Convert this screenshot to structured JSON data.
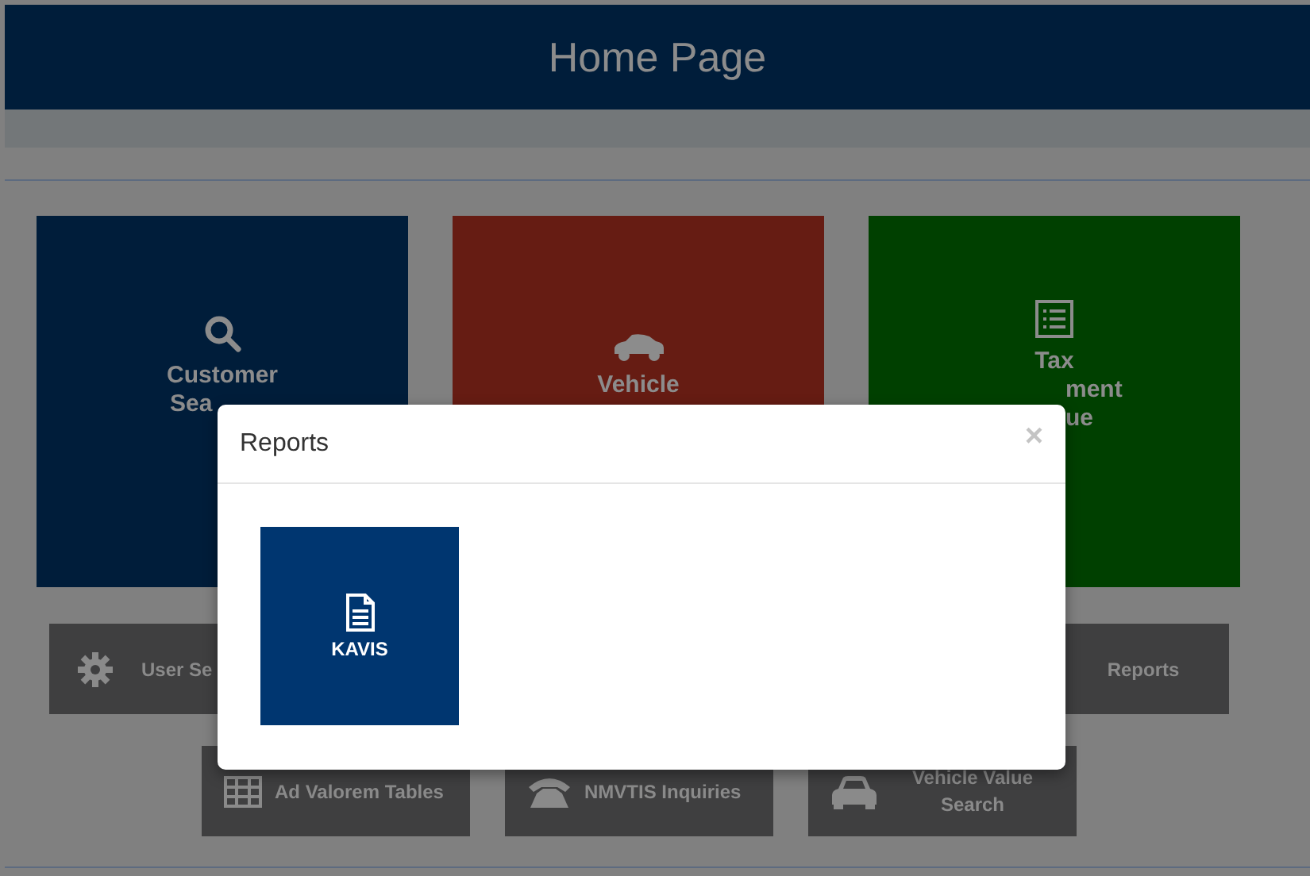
{
  "header": {
    "title": "Home Page"
  },
  "tiles": [
    {
      "kind": "customer",
      "color": "#001d3a",
      "lines": [
        "Customer",
        "Sea"
      ]
    },
    {
      "kind": "vehicle",
      "color": "#661c13",
      "lines": [
        "Vehicle"
      ]
    },
    {
      "kind": "tax",
      "color": "#004000",
      "lines": [
        "Tax",
        "ment",
        "ue"
      ]
    }
  ],
  "buttons_row_1": [
    {
      "kind": "settings",
      "label": "User Se"
    },
    {
      "kind": "reports",
      "label": "Reports"
    }
  ],
  "buttons_row_2": [
    {
      "kind": "tables",
      "label": "Ad Valorem Tables"
    },
    {
      "kind": "phone",
      "label": "NMVTIS Inquiries"
    },
    {
      "kind": "car",
      "label": "Vehicle Value Search"
    }
  ],
  "modal": {
    "title": "Reports",
    "close": "×",
    "items": [
      {
        "kind": "document",
        "label": "KAVIS"
      }
    ]
  }
}
